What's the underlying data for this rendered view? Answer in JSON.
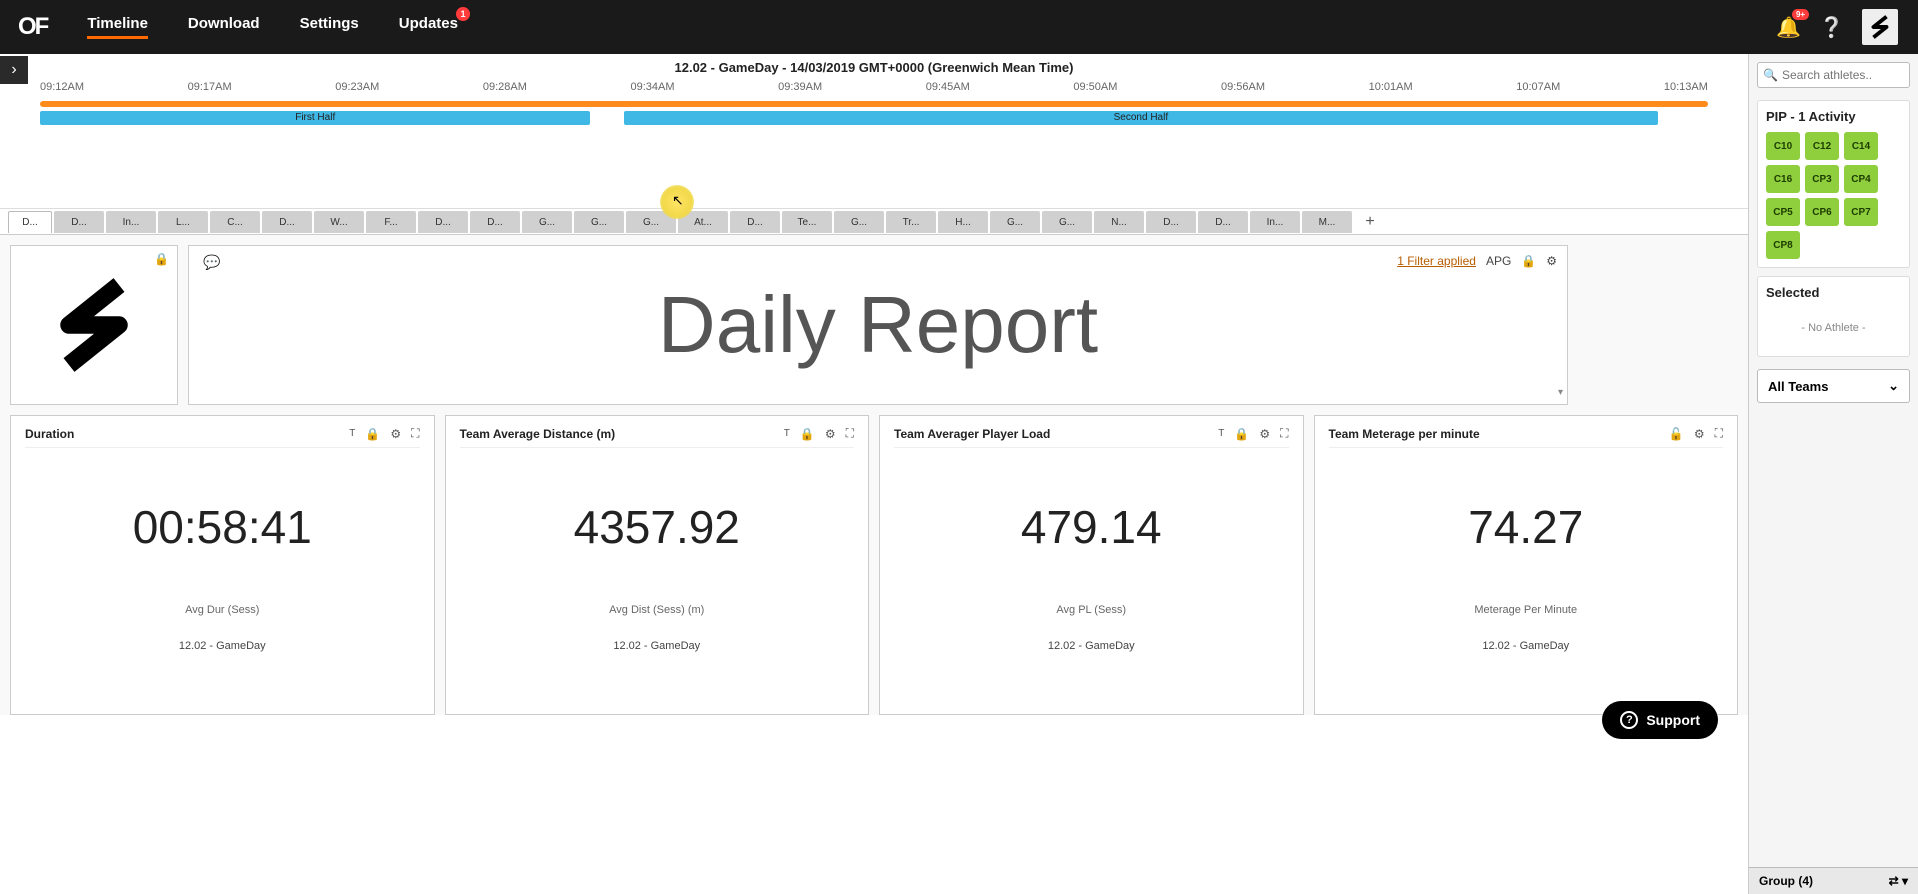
{
  "nav": {
    "logo": "OF",
    "items": [
      "Timeline",
      "Download",
      "Settings",
      "Updates"
    ],
    "active": 0,
    "updates_badge": "1",
    "bell_badge": "9+"
  },
  "timeline": {
    "title": "12.02 - GameDay - 14/03/2019 GMT+0000 (Greenwich Mean Time)",
    "ticks": [
      "09:12AM",
      "09:17AM",
      "09:23AM",
      "09:28AM",
      "09:34AM",
      "09:39AM",
      "09:45AM",
      "09:50AM",
      "09:56AM",
      "10:01AM",
      "10:07AM",
      "10:13AM"
    ],
    "halves": [
      "First Half",
      "Second Half"
    ]
  },
  "tabs": [
    "D...",
    "D...",
    "In...",
    "L...",
    "C...",
    "D...",
    "W...",
    "F...",
    "D...",
    "D...",
    "G...",
    "G...",
    "G...",
    "At...",
    "D...",
    "Te...",
    "G...",
    "Tr...",
    "H...",
    "G...",
    "G...",
    "N...",
    "D...",
    "D...",
    "In...",
    "M..."
  ],
  "title_card": {
    "filter_text": "1 Filter applied",
    "apg": "APG",
    "title": "Daily Report"
  },
  "metrics": [
    {
      "title": "Duration",
      "value": "00:58:41",
      "sub": "Avg Dur (Sess)",
      "session": "12.02 - GameDay",
      "show_t": true
    },
    {
      "title": "Team Average Distance (m)",
      "value": "4357.92",
      "sub": "Avg Dist (Sess) (m)",
      "session": "12.02 - GameDay",
      "show_t": true
    },
    {
      "title": "Team Averager Player Load",
      "value": "479.14",
      "sub": "Avg PL (Sess)",
      "session": "12.02 - GameDay",
      "show_t": true
    },
    {
      "title": "Team Meterage per minute",
      "value": "74.27",
      "sub": "Meterage Per Minute",
      "session": "12.02 - GameDay",
      "show_t": false
    }
  ],
  "right_panel": {
    "search_placeholder": "Search athletes..",
    "activity_title": "PIP - 1 Activity",
    "chips": [
      "C10",
      "C12",
      "C14",
      "C16",
      "CP3",
      "CP4",
      "CP5",
      "CP6",
      "CP7",
      "CP8"
    ],
    "selected_title": "Selected",
    "no_athlete": "- No Athlete -",
    "teams": "All Teams",
    "group_label": "Group (4)"
  },
  "support": "Support"
}
